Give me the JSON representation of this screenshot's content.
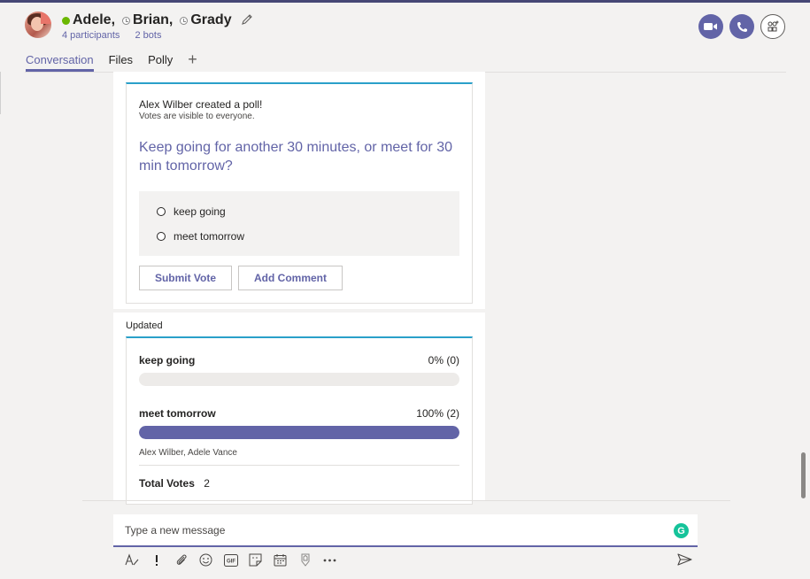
{
  "header": {
    "participants": [
      {
        "name": "Adele,",
        "status": "online"
      },
      {
        "name": "Brian,",
        "status": "away"
      },
      {
        "name": "Grady",
        "status": "away"
      }
    ],
    "participants_count": "4 participants",
    "bots_count": "2 bots"
  },
  "tabs": [
    {
      "label": "Conversation",
      "active": true
    },
    {
      "label": "Files",
      "active": false
    },
    {
      "label": "Polly",
      "active": false
    }
  ],
  "poll_card": {
    "creator_text": "Alex Wilber created a poll!",
    "visibility_text": "Votes are visible to everyone.",
    "question": "Keep going for another 30 minutes, or meet for 30 min tomorrow?",
    "options": [
      "keep going",
      "meet tomorrow"
    ],
    "submit_label": "Submit Vote",
    "comment_label": "Add Comment"
  },
  "results_card": {
    "updated_label": "Updated",
    "results": [
      {
        "label": "keep going",
        "value_text": "0% (0)",
        "fraction": 0
      },
      {
        "label": "meet tomorrow",
        "value_text": "100% (2)",
        "fraction": 1
      }
    ],
    "voters": "Alex Wilber, Adele Vance",
    "total_label": "Total Votes",
    "total_value": "2"
  },
  "compose": {
    "placeholder": "Type a new message",
    "grammarly_letter": "G"
  },
  "toolbar": {
    "icons": [
      "format-icon",
      "important-icon",
      "attach-icon",
      "emoji-icon",
      "gif-icon",
      "sticker-icon",
      "meeting-icon",
      "praise-icon",
      "more-icon",
      "send-icon"
    ]
  },
  "colors": {
    "accent": "#6264a7",
    "online": "#6bb700",
    "card_topbar": "#2aa0c9",
    "grammarly": "#15c39a"
  }
}
